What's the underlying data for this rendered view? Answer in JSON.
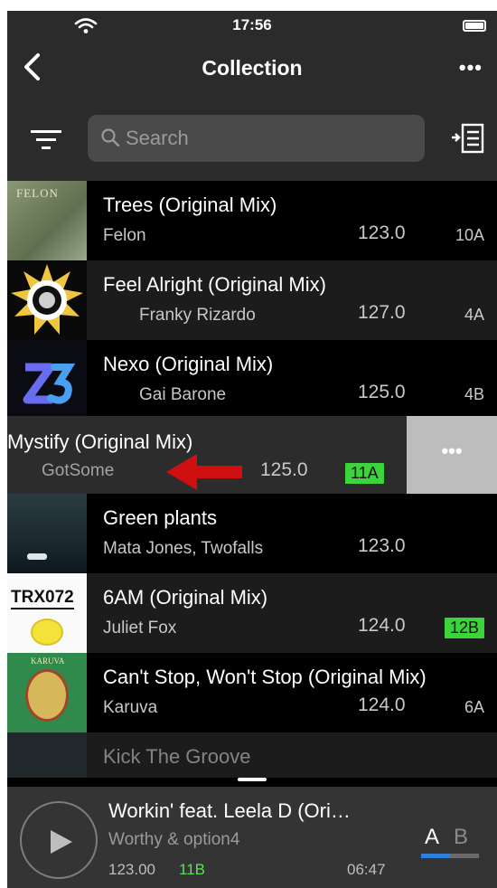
{
  "status": {
    "time": "17:56"
  },
  "nav": {
    "title": "Collection"
  },
  "search": {
    "placeholder": "Search"
  },
  "tracks": [
    {
      "title": "Trees (Original Mix)",
      "artist": "Felon",
      "bpm": "123.0",
      "key": "10A",
      "art_text": "FELON"
    },
    {
      "title": "Feel Alright (Original Mix)",
      "artist": "Franky Rizardo",
      "bpm": "127.0",
      "key": "4A"
    },
    {
      "title": "Nexo (Original Mix)",
      "artist": "Gai Barone",
      "bpm": "125.0",
      "key": "4B"
    },
    {
      "title": "Mystify (Original Mix)",
      "artist": "GotSome",
      "bpm": "125.0",
      "key": "11A",
      "key_highlight": true
    },
    {
      "title": "Green plants",
      "artist": "Mata Jones, Twofalls",
      "bpm": "123.0",
      "key": ""
    },
    {
      "title": "6AM (Original Mix)",
      "artist": "Juliet Fox",
      "bpm": "124.0",
      "key": "12B",
      "key_highlight": true,
      "art_text": "TRX072"
    },
    {
      "title": "Can't Stop, Won't Stop (Original Mix)",
      "artist": "Karuva",
      "bpm": "124.0",
      "key": "6A",
      "art_text": "KARUVA"
    },
    {
      "title": "Kick The Groove"
    }
  ],
  "swipe_action": {
    "label": "•••"
  },
  "player": {
    "title": "Workin' feat. Leela D (Ori…",
    "artist": "Worthy & option4",
    "bpm": "123.00",
    "key": "11B",
    "time": "06:47",
    "deck_a": "A",
    "deck_b": "B",
    "deck_level": 0.5
  },
  "colors": {
    "key_highlight": "#3bd43b",
    "accent_blue": "#2f7fdc",
    "swipe_arrow": "#d01010"
  }
}
